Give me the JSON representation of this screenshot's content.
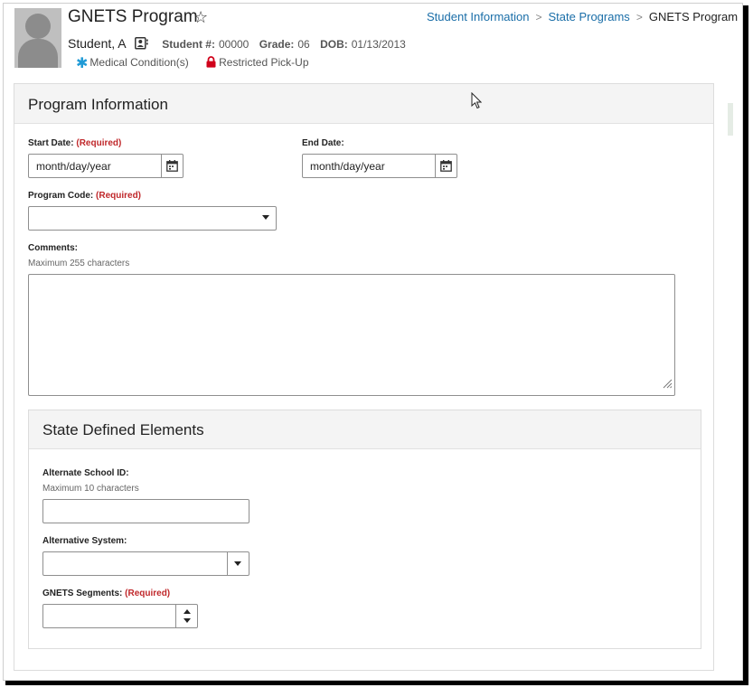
{
  "header": {
    "title": "GNETS Program",
    "student_name": "Student, A",
    "student_number_label": "Student #:",
    "student_number": "00000",
    "grade_label": "Grade:",
    "grade": "06",
    "dob_label": "DOB:",
    "dob": "01/13/2013",
    "flags": {
      "medical": "Medical Condition(s)",
      "restricted": "Restricted Pick-Up"
    }
  },
  "breadcrumb": {
    "items": [
      "Student Information",
      "State Programs",
      "GNETS Program"
    ]
  },
  "program_info": {
    "title": "Program Information",
    "start_date": {
      "label": "Start Date:",
      "required": "(Required)",
      "placeholder": "month/day/year"
    },
    "end_date": {
      "label": "End Date:",
      "placeholder": "month/day/year"
    },
    "program_code": {
      "label": "Program Code:",
      "required": "(Required)",
      "value": ""
    },
    "comments": {
      "label": "Comments:",
      "hint": "Maximum 255 characters",
      "value": ""
    }
  },
  "state_elements": {
    "title": "State Defined Elements",
    "alternate_school_id": {
      "label": "Alternate School ID:",
      "hint": "Maximum 10 characters",
      "value": ""
    },
    "alternative_system": {
      "label": "Alternative System:",
      "value": ""
    },
    "gnets_segments": {
      "label": "GNETS Segments:",
      "required": "(Required)",
      "value": ""
    }
  },
  "colors": {
    "link": "#1a6ea8",
    "required": "#c0282b",
    "medical_icon": "#1f9ad6",
    "lock_icon": "#d0021b"
  }
}
